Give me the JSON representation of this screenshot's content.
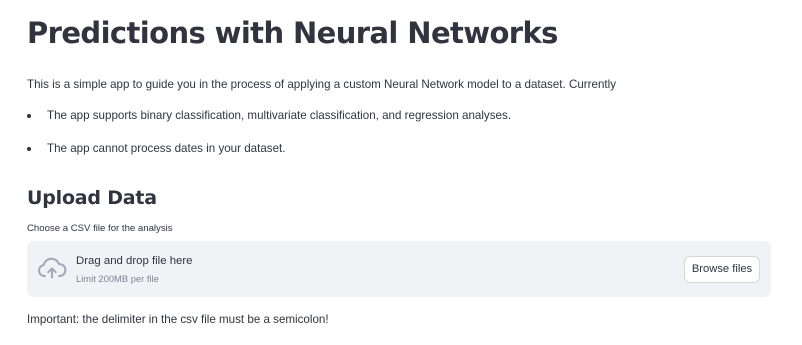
{
  "header": {
    "title": "Predictions with Neural Networks"
  },
  "intro": {
    "text": "This is a simple app to guide you in the process of applying a custom Neural Network model to a dataset. Currently",
    "bullets": [
      "The app supports binary classification, multivariate classification, and regression analyses.",
      "The app cannot process dates in your dataset."
    ]
  },
  "upload": {
    "heading": "Upload Data",
    "label": "Choose a CSV file for the analysis",
    "dropzone_title": "Drag and drop file here",
    "dropzone_limit": "Limit 200MB per file",
    "browse_label": "Browse files",
    "icon": "cloud-upload-icon"
  },
  "notes": {
    "important": "Important: the delimiter in the csv file must be a semicolon!"
  },
  "colors": {
    "text": "#31333f",
    "dropzone_bg": "#f0f2f6",
    "muted_text": "#808495",
    "icon": "#a3a8b8"
  }
}
